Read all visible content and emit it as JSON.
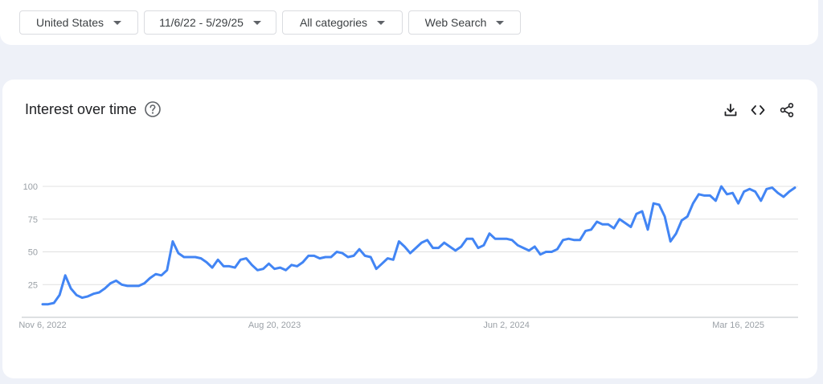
{
  "filters": {
    "region": "United States",
    "date_range": "11/6/22 - 5/29/25",
    "category": "All categories",
    "search_type": "Web Search"
  },
  "card": {
    "title": "Interest over time"
  },
  "icons": {
    "help": "help-circle-icon",
    "download": "download-icon",
    "embed": "code-icon",
    "share": "share-icon"
  },
  "colors": {
    "series": "#4285f4",
    "grid": "#e0e0e0",
    "axis_text": "#9aa0a6"
  },
  "chart_data": {
    "type": "line",
    "title": "Interest over time",
    "xlabel": "",
    "ylabel": "",
    "ylim": [
      0,
      100
    ],
    "yticks": [
      25,
      50,
      75,
      100
    ],
    "x_tick_labels": [
      "Nov 6, 2022",
      "Aug 20, 2023",
      "Jun 2, 2024",
      "Mar 16, 2025"
    ],
    "x_tick_indices": [
      0,
      41,
      82,
      123
    ],
    "grid": true,
    "legend": "none",
    "series": [
      {
        "values": [
          10,
          10,
          11,
          17,
          32,
          22,
          17,
          15,
          16,
          18,
          19,
          22,
          26,
          28,
          25,
          24,
          24,
          24,
          26,
          30,
          33,
          32,
          36,
          58,
          49,
          46,
          46,
          46,
          45,
          42,
          38,
          44,
          39,
          39,
          38,
          44,
          45,
          40,
          36,
          37,
          41,
          37,
          38,
          36,
          40,
          39,
          42,
          47,
          47,
          45,
          46,
          46,
          50,
          49,
          46,
          47,
          52,
          47,
          46,
          37,
          41,
          45,
          44,
          58,
          54,
          49,
          53,
          57,
          59,
          53,
          53,
          57,
          54,
          51,
          54,
          60,
          60,
          53,
          55,
          64,
          60,
          60,
          60,
          59,
          55,
          53,
          51,
          54,
          48,
          50,
          50,
          52,
          59,
          60,
          59,
          59,
          66,
          67,
          73,
          71,
          71,
          68,
          75,
          72,
          69,
          79,
          81,
          67,
          87,
          86,
          77,
          58,
          64,
          74,
          77,
          87,
          94,
          93,
          93,
          89,
          100,
          94,
          95,
          87,
          96,
          98,
          96,
          89,
          98,
          99,
          95,
          92,
          96,
          99
        ]
      }
    ]
  }
}
